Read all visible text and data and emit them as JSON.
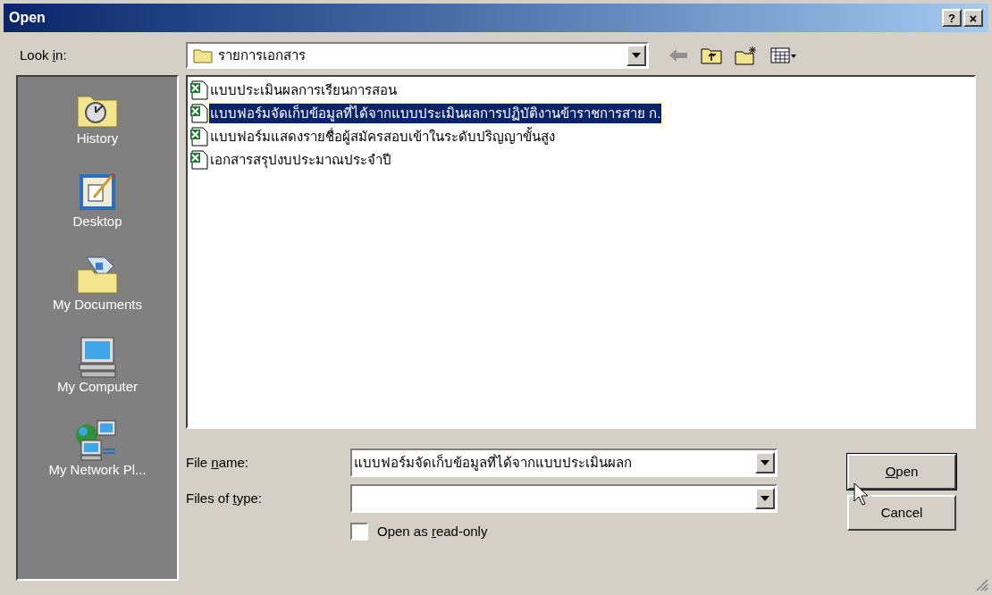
{
  "window": {
    "title": "Open",
    "help_button": "?",
    "close_button": "×"
  },
  "look_in": {
    "label_parts": {
      "before": "Look ",
      "key": "i",
      "after": "n:"
    },
    "value": "รายการเอกสาร"
  },
  "places": [
    {
      "label": "History",
      "kind": "history"
    },
    {
      "label": "Desktop",
      "kind": "desktop"
    },
    {
      "label": "My Documents",
      "kind": "documents"
    },
    {
      "label": "My Computer",
      "kind": "computer"
    },
    {
      "label": "My Network Pl...",
      "kind": "network"
    }
  ],
  "files": [
    {
      "name": "แบบประเมินผลการเรียนการสอน",
      "selected": false
    },
    {
      "name": "แบบฟอร์มจัดเก็บข้อมูลที่ได้จากแบบประเมินผลการปฏิบัติงานข้าราชการสาย ก.",
      "selected": true
    },
    {
      "name": "แบบฟอร์มแสดงรายชื่อผู้สมัครสอบเข้าในระดับปริญญาขั้นสูง",
      "selected": false
    },
    {
      "name": "เอกสารสรุปงบประมาณประจำปี",
      "selected": false
    }
  ],
  "file_name": {
    "label_parts": {
      "before": "File ",
      "key": "n",
      "after": "ame:"
    },
    "value": "แบบฟอร์มจัดเก็บข้อมูลที่ได้จากแบบประเมินผลก"
  },
  "file_type": {
    "label_parts": {
      "before": "Files of ",
      "key": "t",
      "after": "ype:"
    }
  },
  "read_only": {
    "label_parts": {
      "before": "Open as ",
      "key": "r",
      "after": "ead-only"
    },
    "checked": false
  },
  "buttons": [
    {
      "label_parts": {
        "key": "O",
        "after": "pen"
      },
      "kind": "default"
    },
    {
      "label_parts": {
        "before": "Cancel"
      },
      "kind": "normal"
    }
  ]
}
